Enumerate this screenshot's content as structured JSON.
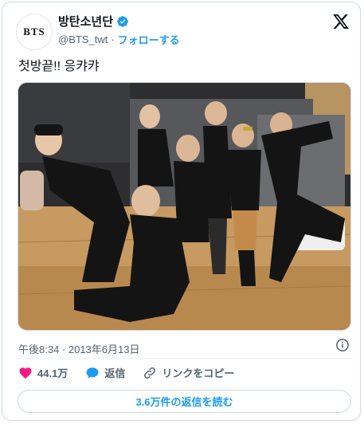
{
  "author": {
    "avatar_text": "BTS",
    "name": "방탄소년단",
    "handle": "@BTS_twt",
    "separator": "·",
    "follow_label": "フォローする"
  },
  "tweet": {
    "text": "첫방끝!! 응캬캬",
    "timestamp": "午後8:34 · 2013年6月13日"
  },
  "actions": {
    "like_count": "44.1万",
    "reply_label": "返信",
    "copy_link_label": "リンクをコピー"
  },
  "footer": {
    "read_replies_label": "3.6万件の返信を読む"
  },
  "colors": {
    "accent": "#1d9bf0",
    "like": "#f91880",
    "secondary_text": "#536471",
    "border": "#cfd9de"
  },
  "icons": {
    "verified": "verified-badge-icon",
    "brand": "x-logo-icon",
    "info": "info-icon",
    "like": "heart-icon",
    "reply": "speech-bubble-icon",
    "link": "link-icon"
  }
}
